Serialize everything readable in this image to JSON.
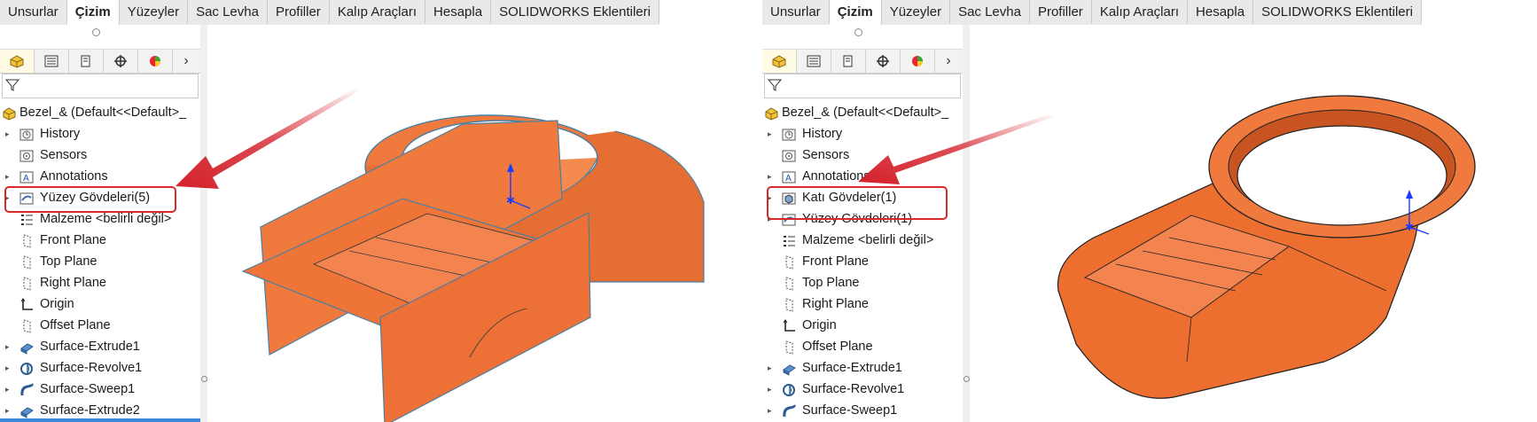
{
  "tabs": [
    {
      "label": "Unsurlar",
      "active": false
    },
    {
      "label": "Çizim",
      "active": true
    },
    {
      "label": "Yüzeyler",
      "active": false
    },
    {
      "label": "Sac Levha",
      "active": false
    },
    {
      "label": "Profiller",
      "active": false
    },
    {
      "label": "Kalıp Araçları",
      "active": false
    },
    {
      "label": "Hesapla",
      "active": false
    },
    {
      "label": "SOLIDWORKS Eklentileri",
      "active": false
    }
  ],
  "panel_toolbar": {
    "icons": [
      "feature-manager-icon",
      "property-manager-icon",
      "configuration-manager-icon",
      "dimxpert-icon",
      "display-manager-icon"
    ],
    "more_glyph": "›"
  },
  "left": {
    "tree": [
      {
        "label": "Bezel_&  (Default<<Default>_",
        "icon": "part-icon",
        "arrow": false,
        "root": true
      },
      {
        "label": "History",
        "icon": "history-icon",
        "arrow": true
      },
      {
        "label": "Sensors",
        "icon": "sensors-icon",
        "arrow": false
      },
      {
        "label": "Annotations",
        "icon": "annotations-icon",
        "arrow": true
      },
      {
        "label": "Yüzey Gövdeleri(5)",
        "icon": "surface-bodies-icon",
        "arrow": true,
        "highlight": true
      },
      {
        "label": "Malzeme <belirli değil>",
        "icon": "material-icon",
        "arrow": false
      },
      {
        "label": "Front Plane",
        "icon": "plane-icon",
        "arrow": false
      },
      {
        "label": "Top Plane",
        "icon": "plane-icon",
        "arrow": false
      },
      {
        "label": "Right Plane",
        "icon": "plane-icon",
        "arrow": false
      },
      {
        "label": "Origin",
        "icon": "origin-icon",
        "arrow": false
      },
      {
        "label": "Offset Plane",
        "icon": "plane-icon",
        "arrow": false
      },
      {
        "label": "Surface-Extrude1",
        "icon": "surface-extrude-icon",
        "arrow": true
      },
      {
        "label": "Surface-Revolve1",
        "icon": "surface-revolve-icon",
        "arrow": true
      },
      {
        "label": "Surface-Sweep1",
        "icon": "surface-sweep-icon",
        "arrow": true
      },
      {
        "label": "Surface-Extrude2",
        "icon": "surface-extrude-icon",
        "arrow": true
      }
    ]
  },
  "right": {
    "tree": [
      {
        "label": "Bezel_&  (Default<<Default>_",
        "icon": "part-icon",
        "arrow": false,
        "root": true
      },
      {
        "label": "History",
        "icon": "history-icon",
        "arrow": true
      },
      {
        "label": "Sensors",
        "icon": "sensors-icon",
        "arrow": false
      },
      {
        "label": "Annotations",
        "icon": "annotations-icon",
        "arrow": true
      },
      {
        "label": "Katı Gövdeler(1)",
        "icon": "solid-bodies-icon",
        "arrow": true,
        "highlight": true
      },
      {
        "label": "Yüzey Gövdeleri(1)",
        "icon": "surface-bodies-icon",
        "arrow": true
      },
      {
        "label": "Malzeme <belirli değil>",
        "icon": "material-icon",
        "arrow": false
      },
      {
        "label": "Front Plane",
        "icon": "plane-icon",
        "arrow": false
      },
      {
        "label": "Top Plane",
        "icon": "plane-icon",
        "arrow": false
      },
      {
        "label": "Right Plane",
        "icon": "plane-icon",
        "arrow": false
      },
      {
        "label": "Origin",
        "icon": "origin-icon",
        "arrow": false
      },
      {
        "label": "Offset Plane",
        "icon": "plane-icon",
        "arrow": false
      },
      {
        "label": "Surface-Extrude1",
        "icon": "surface-extrude-icon",
        "arrow": true
      },
      {
        "label": "Surface-Revolve1",
        "icon": "surface-revolve-icon",
        "arrow": true
      },
      {
        "label": "Surface-Sweep1",
        "icon": "surface-sweep-icon",
        "arrow": true
      }
    ]
  },
  "colors": {
    "model": "#f07a3e",
    "model_dark": "#c95a25",
    "edge": "#4a7fa3",
    "highlight": "#d62a2a",
    "arrow": "#d4202a",
    "active_tab": "#ffffff"
  }
}
